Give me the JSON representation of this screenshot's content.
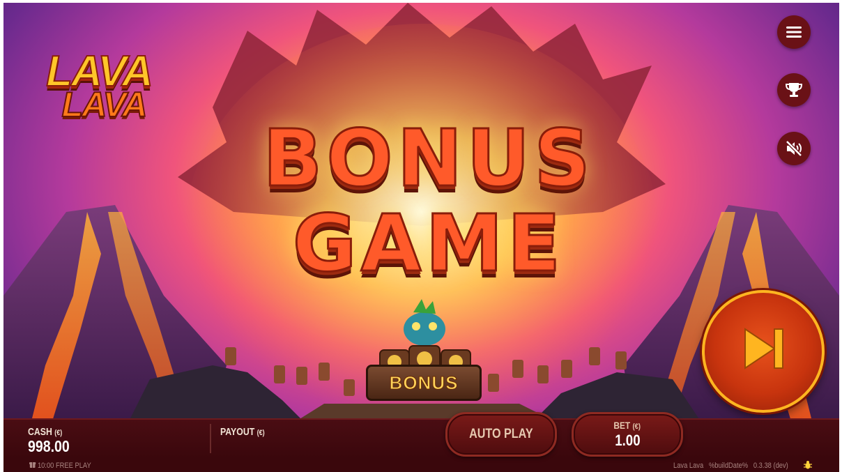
{
  "game": {
    "logo_line1": "LAVA",
    "logo_line2": "LAVA",
    "title_line1": "BONUS",
    "title_line2": "GAME",
    "sign_text": "BONUS"
  },
  "side_buttons": {
    "menu_icon": "hamburger-menu-icon",
    "trophy_icon": "trophy-icon",
    "sound_icon": "sound-muted-icon"
  },
  "hud": {
    "cash_label": "CASH",
    "currency_symbol": "(€)",
    "cash_value": "998.00",
    "payout_label": "PAYOUT",
    "autoplay_label": "AUTO PLAY",
    "bet_label": "BET",
    "bet_value": "1.00",
    "free_play_text": "10:00 FREE PLAY",
    "build_game_name": "Lava Lava",
    "build_date": "%buildDate%",
    "build_version": "0.3.38 (dev)"
  },
  "colors": {
    "accent_gold": "#ffb520",
    "button_red": "#c8340e",
    "hud_bg": "#3a070c"
  }
}
